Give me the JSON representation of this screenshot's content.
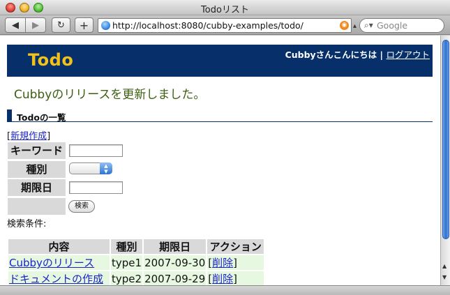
{
  "window": {
    "title": "Todoリスト"
  },
  "toolbar": {
    "back_icon": "arrow-left-icon",
    "forward_icon": "arrow-right-icon",
    "reload_icon": "reload-icon",
    "add_icon": "plus-icon",
    "url": "http://localhost:8080/cubby-examples/todo/",
    "search_placeholder": "Google"
  },
  "header": {
    "logo": "Todo",
    "greeting": "Cubbyさんこんにちは",
    "separator": "|",
    "logout": "ログアウト",
    "bg_color": "#07306a",
    "logo_color": "#f1c21b"
  },
  "flash_message": "Cubbyのリリースを更新しました。",
  "section_title": "Todoの一覧",
  "new_link": {
    "open": "[",
    "label": "新規作成",
    "close": "]"
  },
  "search_form": {
    "keyword_label": "キーワード",
    "keyword_value": "",
    "type_label": "種別",
    "type_value": "",
    "due_label": "期限日",
    "due_value": "",
    "submit_label": "検索"
  },
  "search_conditions_label": "検索条件:",
  "todo_table": {
    "columns": [
      "内容",
      "種別",
      "期限日",
      "アクション"
    ],
    "rows": [
      {
        "title": "Cubbyのリリース",
        "type": "type1",
        "due": "2007-09-30",
        "action": "削除"
      },
      {
        "title": "ドキュメントの作成",
        "type": "type2",
        "due": "2007-09-29",
        "action": "削除"
      }
    ]
  }
}
